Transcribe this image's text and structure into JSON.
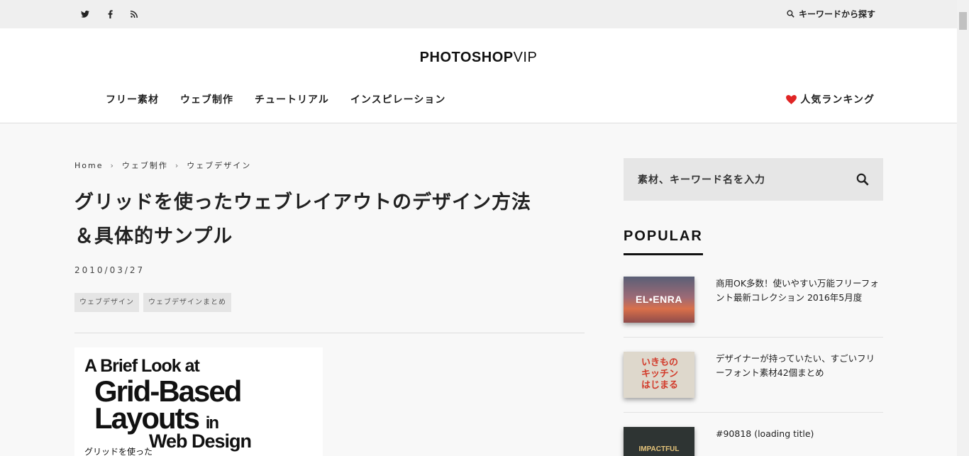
{
  "topbar": {
    "social": [
      {
        "name": "twitter-icon",
        "glyph": "🐦"
      },
      {
        "name": "facebook-icon",
        "glyph": "f"
      },
      {
        "name": "rss-icon",
        "glyph": "☰"
      }
    ],
    "search_label": "キーワードから探す"
  },
  "header": {
    "logo_main": "PHOTOSHOP",
    "logo_suffix": "VIP",
    "nav": [
      "フリー素材",
      "ウェブ制作",
      "チュートリアル",
      "インスピレーション"
    ],
    "ranking_label": "人気ランキング"
  },
  "breadcrumb": {
    "home": "Home",
    "level1": "ウェブ制作",
    "level2": "ウェブデザイン",
    "separator": "›"
  },
  "article": {
    "title": "グリッドを使ったウェブレイアウトのデザイン方法＆具体的サンプル",
    "date": "2010/03/27",
    "tags": [
      "ウェブデザイン",
      "ウェブデザインまとめ"
    ]
  },
  "hero": {
    "line1": "A Brief Look at",
    "line2": "Grid-Based",
    "line3": "Layouts",
    "line3b": "in",
    "line4": "Web Design",
    "caption": "グリッドを使った"
  },
  "sidebar": {
    "search_placeholder": "素材、キーワード名を入力",
    "popular_heading": "POPULAR",
    "posts": [
      {
        "title": "商用OK多数！使いやすい万能フリーフォント最新コレクション 2016年5月度",
        "thumb_text": "EL•ENRA"
      },
      {
        "title": "デザイナーが持っていたい、すごいフリーフォント素材42個まとめ",
        "thumb_text": "いきものキッチンはじまる"
      },
      {
        "title": "#90818 (loading title)",
        "thumb_text": "IMPACTFUL"
      }
    ]
  },
  "colors": {
    "accent_heart": "#e02525",
    "topbar_bg": "#efefef",
    "page_bg": "#f8f8f8"
  }
}
